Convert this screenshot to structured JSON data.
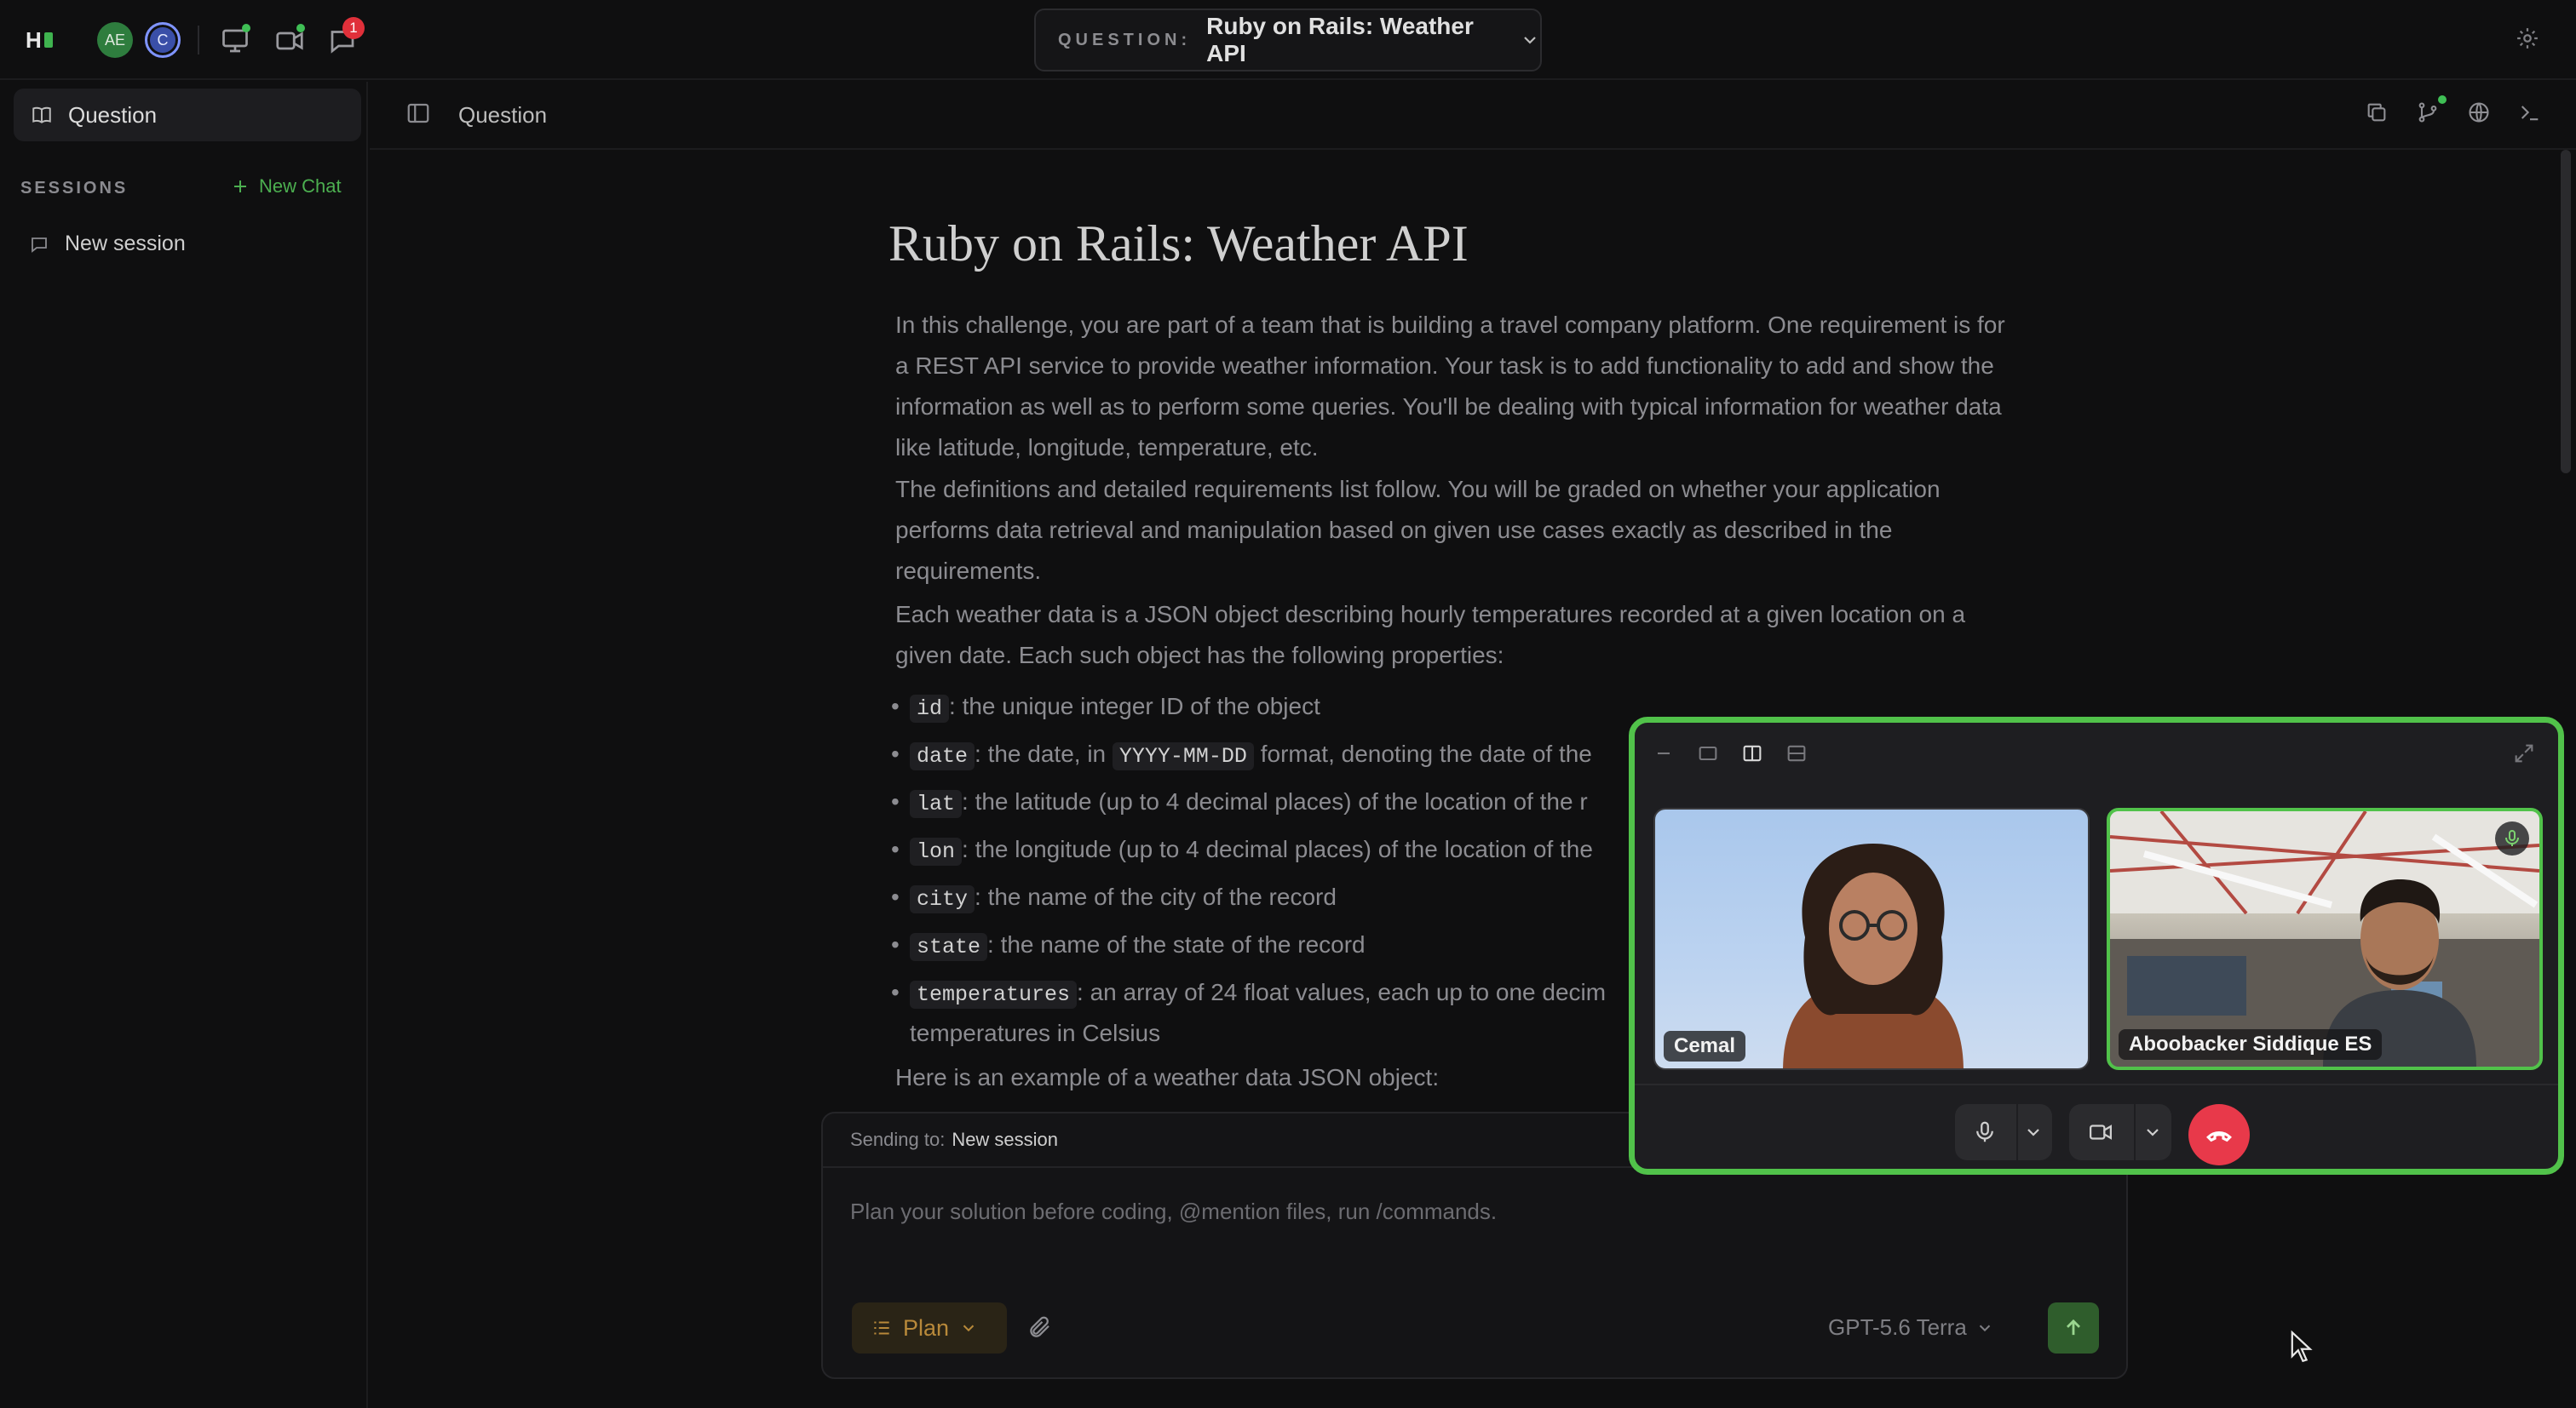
{
  "topbar": {
    "logo_text": "H",
    "avatars": [
      {
        "initials": "AE"
      },
      {
        "initials": "C"
      }
    ],
    "notification_count": "1",
    "question_label": "QUESTION:",
    "question_value": "Ruby on Rails: Weather API"
  },
  "sidebar": {
    "question_label": "Question",
    "sessions_heading": "SESSIONS",
    "new_chat_label": "New Chat",
    "sessions": [
      {
        "label": "New session"
      }
    ]
  },
  "main_header": {
    "title": "Question"
  },
  "document": {
    "title": "Ruby on Rails: Weather API",
    "paragraphs": [
      [
        "In this challenge, you are part of a team that is building a travel company platform. One requirement is for",
        "a REST API service to provide weather information. Your task is to add functionality to add and show the",
        "information as well as to perform some queries. You'll be dealing with typical information for weather data",
        "like latitude, longitude, temperature, etc."
      ],
      [
        "The definitions and detailed requirements list follow. You will be graded on whether your application",
        "performs data retrieval and manipulation based on given use cases exactly as described in the",
        "requirements."
      ],
      [
        "Each weather data is a JSON object describing hourly temperatures recorded at a given location on a",
        "given date. Each such object has the following properties:"
      ]
    ],
    "bullets": [
      {
        "code": "id",
        "text": ": the unique integer ID of the object"
      },
      {
        "code": "date",
        "text": ": the date, in",
        "code2": "YYYY-MM-DD",
        "text2": "format, denoting the date of the"
      },
      {
        "code": "lat",
        "text": ": the latitude (up to 4 decimal places) of the location of the r"
      },
      {
        "code": "lon",
        "text": ": the longitude (up to 4 decimal places) of the location of the"
      },
      {
        "code": "city",
        "text": ": the name of the city of the record"
      },
      {
        "code": "state",
        "text": ": the name of the state of the record"
      },
      {
        "code": "temperatures",
        "text": ": an array of 24 float values, each up to one decim",
        "line2": "temperatures in Celsius"
      }
    ],
    "trailing": "Here is an example of a weather data JSON object:"
  },
  "composer": {
    "sending_to_label": "Sending to:",
    "sending_to_value": "New session",
    "placeholder": "Plan your solution before coding, @mention files, run /commands.",
    "mode_label": "Plan",
    "model_label": "GPT-5.6 Terra"
  },
  "video_call": {
    "participants": [
      {
        "name": "Cemal"
      },
      {
        "name": "Aboobacker Siddique ES"
      }
    ]
  },
  "colors": {
    "accent_green": "#51c24a",
    "hangup_red": "#e8394a",
    "badge_red": "#e0303a",
    "plan_amber": "#b8893a"
  }
}
